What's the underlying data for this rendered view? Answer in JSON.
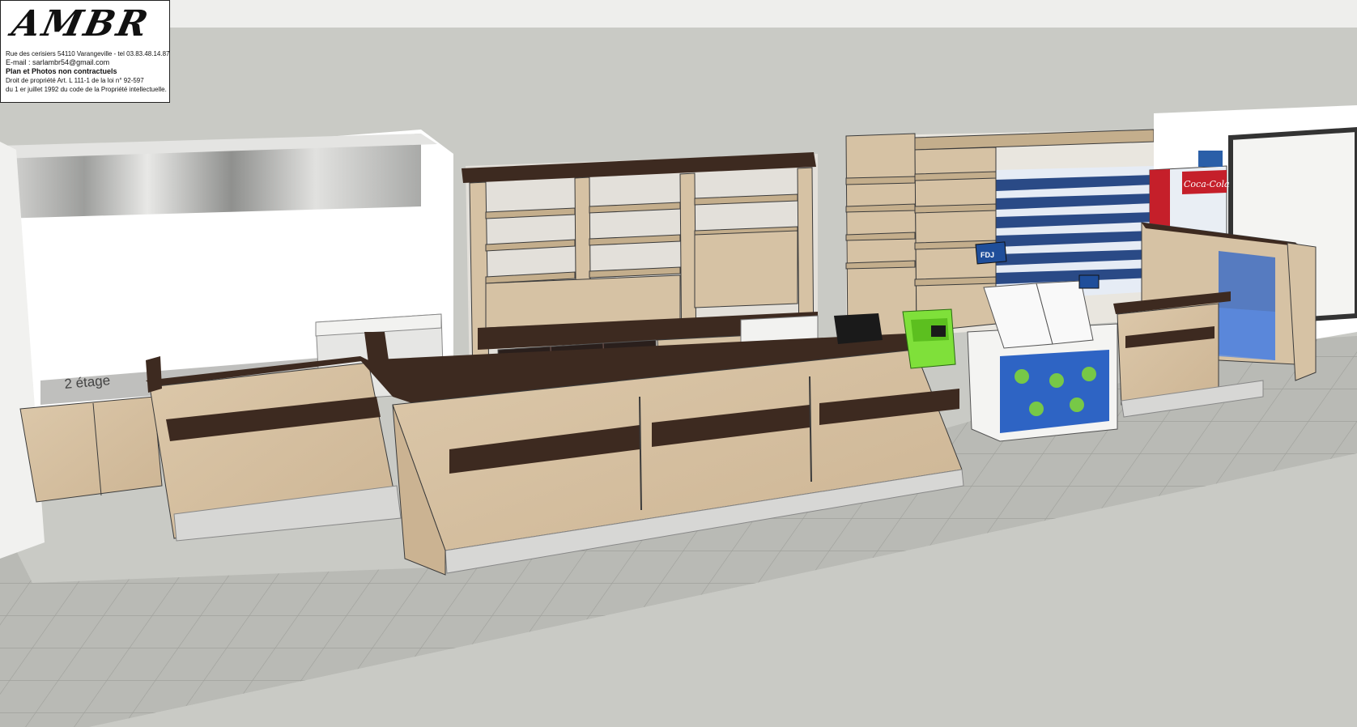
{
  "logo": {
    "title": "AMBR",
    "address": "Rue des cerisiers 54110 Varangeville - tel 03.83.48.14.87",
    "email": "E-mail : sarlambr54@gmail.com",
    "disclaimer": "Plan et Photos non contractuels",
    "rights_1": "Droit de propriété Art. L 111-1 de la loi n° 92-597",
    "rights_2": "du 1 er juillet 1992 du code de la Propriété intellectuelle."
  },
  "labels": {
    "counter_text": "2 étage",
    "fdj_sign": "FDJ",
    "cola_brand": "Coca-Cola"
  },
  "colors": {
    "background": "#c9cac5",
    "floor": "#b7b8b3",
    "wood_light": "#d6c2a4",
    "wood_dark": "#3d2a20",
    "steel": "#c8c9c7",
    "accent_green": "#7fe03a",
    "lottery_blue": "#1f4e9a",
    "cola_red": "#c51f2a"
  }
}
